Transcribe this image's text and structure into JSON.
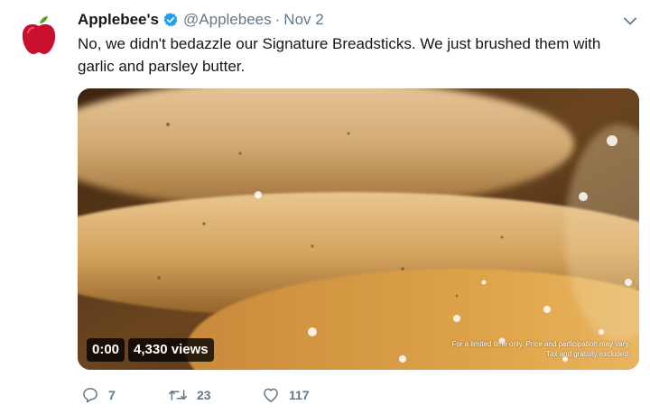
{
  "account": {
    "display_name": "Applebee's",
    "handle": "@Applebees",
    "separator": "·",
    "date": "Nov 2",
    "verified": true,
    "avatar_icon": "apple-icon",
    "brand_color": "#c8102e"
  },
  "tweet": {
    "text": "No, we didn't bedazzle our Signature Breadsticks. We just brushed them with garlic and parsley butter."
  },
  "video": {
    "timestamp": "0:00",
    "views": "4,330 views",
    "disclaimer": "For a limited time only. Price and participation may vary. Tax and gratuity excluded."
  },
  "actions": {
    "replies": "7",
    "retweets": "23",
    "likes": "117",
    "reply_icon": "reply-icon",
    "retweet_icon": "retweet-icon",
    "like_icon": "heart-icon"
  },
  "colors": {
    "text_primary": "#14171a",
    "text_secondary": "#657786",
    "verified_blue": "#1da1f2"
  }
}
